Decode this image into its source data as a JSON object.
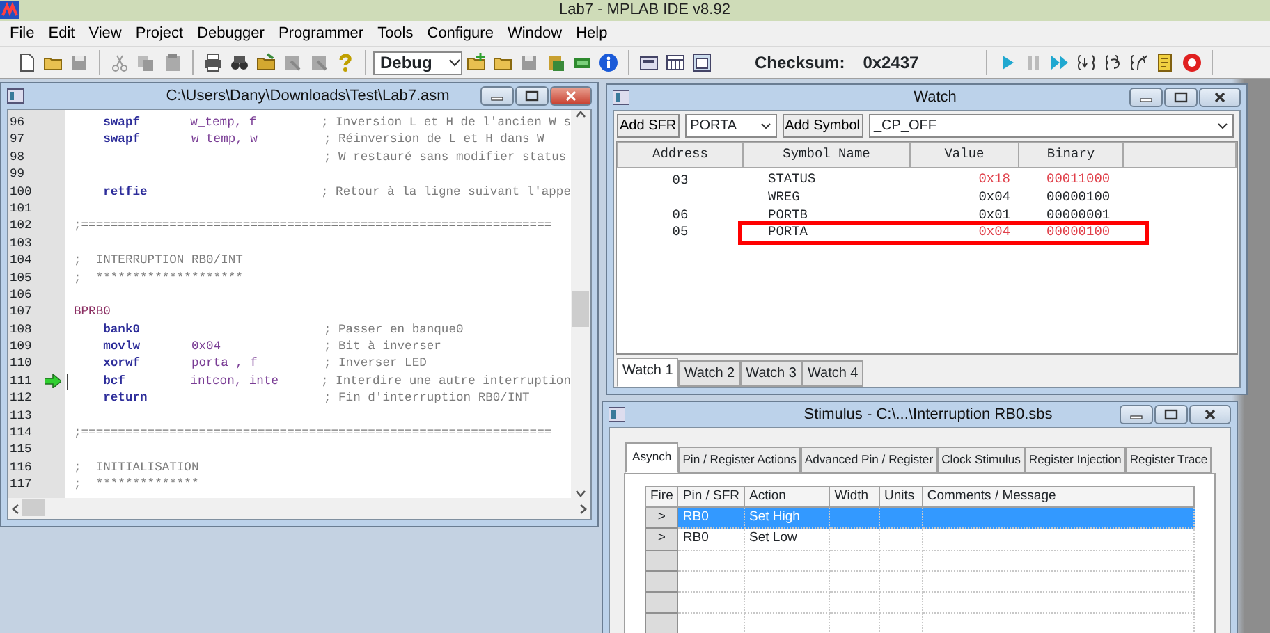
{
  "app": {
    "title": "Lab7 - MPLAB IDE v8.92"
  },
  "menu": [
    "File",
    "Edit",
    "View",
    "Project",
    "Debugger",
    "Programmer",
    "Tools",
    "Configure",
    "Window",
    "Help"
  ],
  "toolbar": {
    "build_config": "Debug",
    "checksum_label": "Checksum:",
    "checksum": "0x2437"
  },
  "editor": {
    "title": "C:\\Users\\Dany\\Downloads\\Test\\Lab7.asm",
    "lines": [
      {
        "number": "96",
        "kind": "code",
        "mnemonic": "swapf",
        "operands": "w_temp, f",
        "comment": "; Inversion L et H de l'ancien W s",
        "current": false
      },
      {
        "number": "97",
        "kind": "code",
        "mnemonic": "swapf",
        "operands": "w_temp, w",
        "comment": "; Réinversion de L et H dans W",
        "current": false
      },
      {
        "number": "98",
        "kind": "code",
        "comment": "; W restauré sans modifier status",
        "current": false
      },
      {
        "number": "99",
        "kind": "blank",
        "current": false
      },
      {
        "number": "100",
        "kind": "code",
        "mnemonic": "retfie",
        "comment": "; Retour à la ligne suivant l'appe",
        "current": false
      },
      {
        "number": "101",
        "kind": "blank",
        "current": false
      },
      {
        "number": "102",
        "kind": "comment",
        "comment": ";================================================================",
        "current": false
      },
      {
        "number": "103",
        "kind": "blank",
        "current": false
      },
      {
        "number": "104",
        "kind": "comment",
        "comment": ";  INTERRUPTION RB0/INT",
        "current": false
      },
      {
        "number": "105",
        "kind": "comment",
        "comment": ";  ********************",
        "current": false
      },
      {
        "number": "106",
        "kind": "blank",
        "current": false
      },
      {
        "number": "107",
        "kind": "label",
        "label": "BPRB0",
        "current": false
      },
      {
        "number": "108",
        "kind": "code",
        "mnemonic": "bank0",
        "comment": "; Passer en banque0",
        "current": false
      },
      {
        "number": "109",
        "kind": "code",
        "mnemonic": "movlw",
        "operands": "0x04",
        "comment": "; Bit à inverser",
        "current": false
      },
      {
        "number": "110",
        "kind": "code",
        "mnemonic": "xorwf",
        "operands": "porta , f",
        "comment": "; Inverser LED",
        "current": false
      },
      {
        "number": "111",
        "kind": "code",
        "mnemonic": "bcf",
        "operands": "intcon, inte",
        "comment": "; Interdire une autre interruption",
        "current": true
      },
      {
        "number": "112",
        "kind": "code",
        "mnemonic": "return",
        "comment": "; Fin d'interruption RB0/INT",
        "current": false
      },
      {
        "number": "113",
        "kind": "blank",
        "current": false
      },
      {
        "number": "114",
        "kind": "comment",
        "comment": ";================================================================",
        "current": false
      },
      {
        "number": "115",
        "kind": "blank",
        "current": false
      },
      {
        "number": "116",
        "kind": "comment",
        "comment": ";  INITIALISATION",
        "current": false
      },
      {
        "number": "117",
        "kind": "comment",
        "comment": ";  **************",
        "current": false
      }
    ]
  },
  "watch": {
    "title": "Watch",
    "add_sfr": "Add SFR",
    "sfr": "PORTA",
    "add_symbol": "Add Symbol",
    "symbol": "_CP_OFF",
    "columns": [
      "Address",
      "Symbol Name",
      "Value",
      "Binary"
    ],
    "rows": [
      {
        "address": "03",
        "symbol": "STATUS",
        "value": "0x18",
        "binary": "00011000",
        "changed": true,
        "highlighted": false
      },
      {
        "symbol": "WREG",
        "value": "0x04",
        "binary": "00000100",
        "changed": false,
        "highlighted": false
      },
      {
        "address": "06",
        "symbol": "PORTB",
        "value": "0x01",
        "binary": "00000001",
        "changed": false,
        "highlighted": false
      },
      {
        "address": "05",
        "symbol": "PORTA",
        "value": "0x04",
        "binary": "00000100",
        "changed": true,
        "highlighted": true
      }
    ],
    "tabs": [
      {
        "label": "Watch 1",
        "selected": true
      },
      {
        "label": "Watch 2",
        "selected": false
      },
      {
        "label": "Watch 3",
        "selected": false
      },
      {
        "label": "Watch 4",
        "selected": false
      }
    ]
  },
  "stimulus": {
    "title": "Stimulus - C:\\...\\Interruption RB0.sbs",
    "tabs": [
      {
        "label": "Asynch",
        "selected": true
      },
      {
        "label": "Pin / Register Actions",
        "selected": false
      },
      {
        "label": "Advanced Pin / Register",
        "selected": false
      },
      {
        "label": "Clock Stimulus",
        "selected": false
      },
      {
        "label": "Register Injection",
        "selected": false
      },
      {
        "label": "Register Trace",
        "selected": false
      }
    ],
    "columns": [
      "Fire",
      "Pin / SFR",
      "Action",
      "Width",
      "Units",
      "Comments / Message"
    ],
    "rows": [
      {
        "fire": ">",
        "pin": "RB0",
        "action": "Set High",
        "selected": true
      },
      {
        "fire": ">",
        "pin": "RB0",
        "action": "Set Low",
        "selected": false
      }
    ]
  }
}
